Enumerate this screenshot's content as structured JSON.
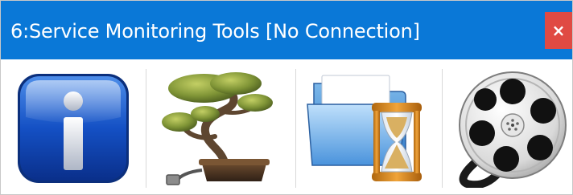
{
  "window": {
    "title": "6:Service Monitoring Tools [No Connection]",
    "close_label": "×",
    "accent_color": "#0a78d7",
    "close_color": "#e04a43"
  },
  "toolbar": {
    "buttons": [
      {
        "icon": "info-icon"
      },
      {
        "icon": "bonsai-tree-icon"
      },
      {
        "icon": "folder-hourglass-icon"
      },
      {
        "icon": "film-reel-icon"
      }
    ]
  }
}
